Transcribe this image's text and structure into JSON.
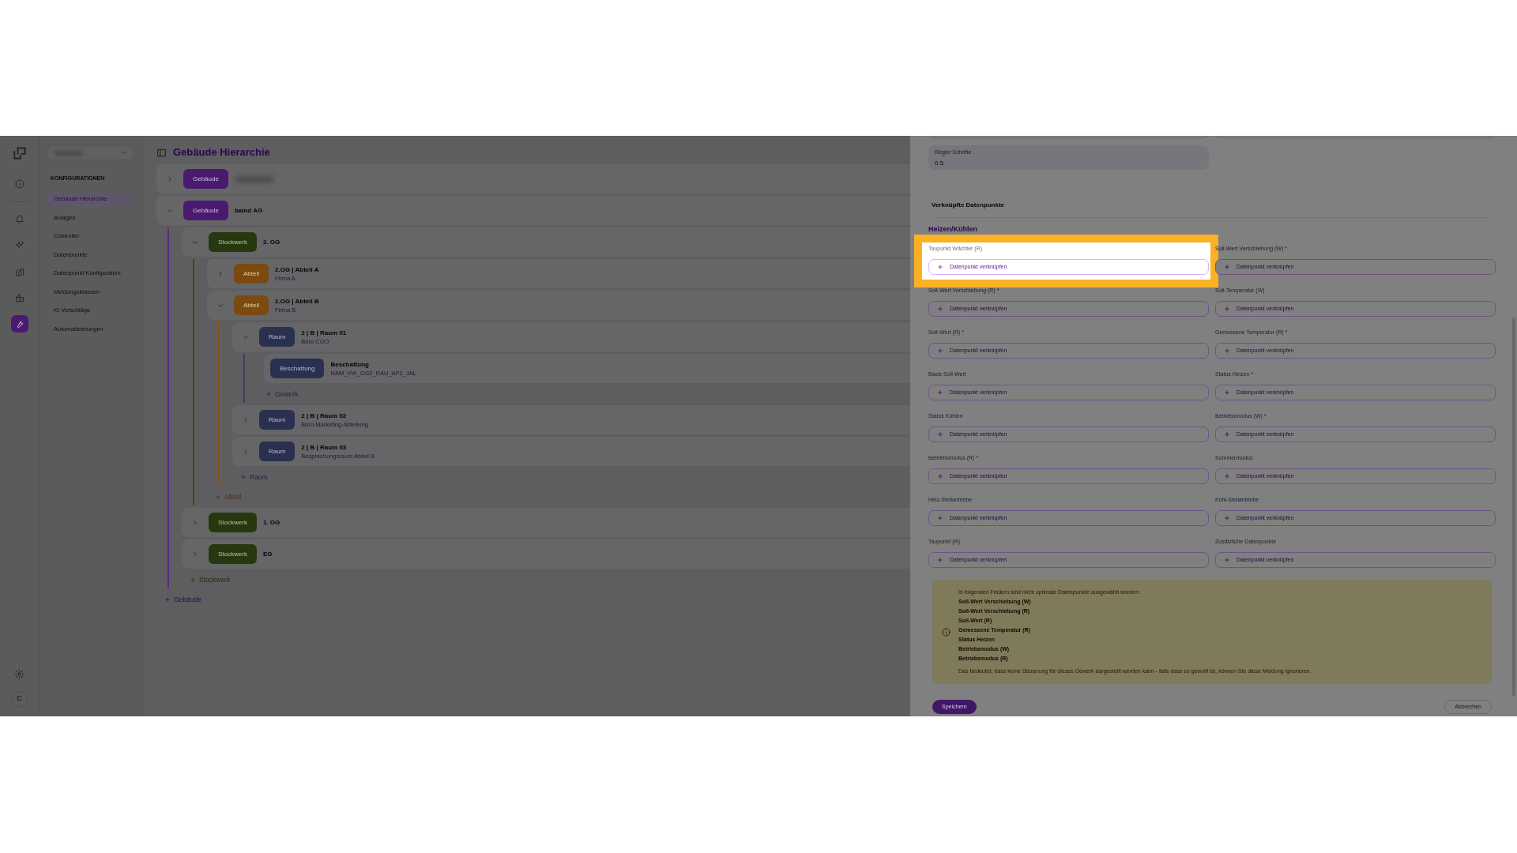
{
  "rail_items": [
    {
      "kind": "info",
      "selected": false
    },
    {
      "kind": "bell",
      "selected": false
    },
    {
      "kind": "sparkle",
      "selected": false
    },
    {
      "kind": "building",
      "selected": false
    },
    {
      "kind": "factory",
      "selected": false
    },
    {
      "kind": "wrench",
      "selected": true
    }
  ],
  "avatar": "C",
  "sidebar": {
    "heading": "KONFIGURATIONEN",
    "items": [
      {
        "label": "Gebäude Hierarchie",
        "selected": true
      },
      {
        "label": "Anlagen",
        "selected": false
      },
      {
        "label": "Controller",
        "selected": false
      },
      {
        "label": "Datenpunkte",
        "selected": false
      },
      {
        "label": "Datenpunkt Konfiguration",
        "selected": false
      },
      {
        "label": "Meldungsklassen",
        "selected": false
      },
      {
        "label": "KI Vorschläge",
        "selected": false
      },
      {
        "label": "Automatisierungen",
        "selected": false
      }
    ]
  },
  "page_title": "Gebäude Hierarchie",
  "tree": {
    "nodes": [
      {
        "kind": "building",
        "tag": "Gebäude",
        "expanded": false
      },
      {
        "kind": "building",
        "tag": "Gebäude",
        "title": "baind AG",
        "expanded": true,
        "add_label": "Stockwerk",
        "children": [
          {
            "kind": "floor",
            "tag": "Stockwerk",
            "title": "2. OG",
            "expanded": true,
            "add_label": "Abteil",
            "children": [
              {
                "kind": "section",
                "tag": "Abteil",
                "title": "2.OG | Abteil A",
                "subtitle": "Firma A",
                "expanded": false
              },
              {
                "kind": "section",
                "tag": "Abteil",
                "title": "2.OG | Abteil B",
                "subtitle": "Firma B",
                "expanded": true,
                "add_label": "Raum",
                "children": [
                  {
                    "kind": "room",
                    "tag": "Raum",
                    "title": "2 | B | Raum 01",
                    "subtitle": "Büro COO",
                    "expanded": true,
                    "add_label": "Gewerk",
                    "children": [
                      {
                        "kind": "trade",
                        "tag": "Beschattung",
                        "title": "Beschattung",
                        "subtitle": "NAM_VW_OG2_RAU_AP1_JAL"
                      }
                    ]
                  },
                  {
                    "kind": "room",
                    "tag": "Raum",
                    "title": "2 | B | Raum 02",
                    "subtitle": "Büro Marketing-Abteilung",
                    "expanded": false
                  },
                  {
                    "kind": "room",
                    "tag": "Raum",
                    "title": "2 | B | Raum 03",
                    "subtitle": "Besprechungsraum Abteil B",
                    "expanded": false
                  }
                ]
              }
            ]
          },
          {
            "kind": "floor",
            "tag": "Stockwerk",
            "title": "1. OG",
            "expanded": false
          },
          {
            "kind": "floor",
            "tag": "Stockwerk",
            "title": "EG",
            "expanded": false
          }
        ]
      }
    ],
    "add_label": "Gebäude"
  },
  "drawer": {
    "regler": {
      "label": "Regler Schritte",
      "value": "0.5"
    },
    "section_title": "Verknüpfte Datenpunkte",
    "group_title": "Heizen/Kühlen",
    "fields": [
      {
        "label": "Taupunkt Wächter (R)",
        "button": "Datenpunkt verknüpfen",
        "highlighted": true
      },
      {
        "label": "Soll-Wert Verschiebung (W) *",
        "button": "Datenpunkt verknüpfen",
        "highlighted": false
      },
      {
        "label": "Soll-Wert Verschiebung (R) *",
        "button": "Datenpunkt verknüpfen",
        "highlighted": false
      },
      {
        "label": "Soll-Temperatur (W)",
        "button": "Datenpunkt verknüpfen",
        "highlighted": false
      },
      {
        "label": "Soll-Wert (R) *",
        "button": "Datenpunkt verknüpfen",
        "highlighted": false
      },
      {
        "label": "Gemessene Temperatur (R) *",
        "button": "Datenpunkt verknüpfen",
        "highlighted": false
      },
      {
        "label": "Basis Soll-Wert",
        "button": "Datenpunkt verknüpfen",
        "highlighted": false
      },
      {
        "label": "Status Heizen *",
        "button": "Datenpunkt verknüpfen",
        "highlighted": false
      },
      {
        "label": "Status Kühlen",
        "button": "Datenpunkt verknüpfen",
        "highlighted": false
      },
      {
        "label": "Betriebsmodus (W) *",
        "button": "Datenpunkt verknüpfen",
        "highlighted": false
      },
      {
        "label": "Betriebsmodus (R) *",
        "button": "Datenpunkt verknüpfen",
        "highlighted": false
      },
      {
        "label": "Sommermodus",
        "button": "Datenpunkt verknüpfen",
        "highlighted": false
      },
      {
        "label": "Heiz-Stellantriebe",
        "button": "Datenpunkt verknüpfen",
        "highlighted": false
      },
      {
        "label": "Kühl-Stellantriebe",
        "button": "Datenpunkt verknüpfen",
        "highlighted": false
      },
      {
        "label": "Taupunkt (R)",
        "button": "Datenpunkt verknüpfen",
        "highlighted": false
      },
      {
        "label": "Zusätzliche Datenpunkte",
        "button": "Datenpunkt verknüpfen",
        "highlighted": false
      }
    ],
    "warning": {
      "intro": "In folgenden Feldern sind nicht optimale Datenpunkte ausgewählt worden:",
      "items": [
        "Soll-Wert Verschiebung (W)",
        "Soll-Wert Verschiebung (R)",
        "Soll-Wert (R)",
        "Gemessene Temperatur (R)",
        "Status Heizen",
        "Betriebsmodus (W)",
        "Betriebsmodus (R)"
      ],
      "outro": "Das bedeutet, dass keine Steuerung für dieses Gewerk dargestellt werden kann - falls dass so gewollt ist, können Sie diese Meldung ignorieren."
    },
    "save": "Speichern",
    "cancel": "Abbrechen"
  }
}
